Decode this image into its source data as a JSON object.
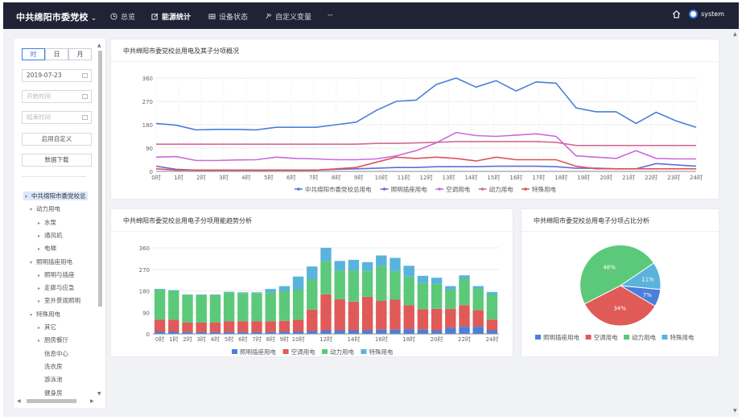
{
  "header": {
    "brand": "中共绵阳市委党校",
    "nav": [
      {
        "label": "总览",
        "icon": "clock-icon",
        "active": false
      },
      {
        "label": "能源统计",
        "icon": "edit-icon",
        "active": true
      },
      {
        "label": "设备状态",
        "icon": "grid-icon",
        "active": false
      },
      {
        "label": "自定义变量",
        "icon": "pin-icon",
        "active": false
      },
      {
        "label": "--",
        "icon": "",
        "active": false
      }
    ],
    "user": "system"
  },
  "sidebar": {
    "tabs": [
      "时",
      "日",
      "月"
    ],
    "date_value": "2019-07-23",
    "start_placeholder": "开始时间",
    "end_placeholder": "结束时间",
    "custom_button": "启用自定义",
    "download_button": "数据下载",
    "tree": [
      {
        "label": "中共绵阳市委党校总",
        "level": 0,
        "bullet": "▾",
        "selected": true
      },
      {
        "label": "动力用电",
        "level": 1,
        "bullet": "▾"
      },
      {
        "label": "水泵",
        "level": 2,
        "bullet": "▸"
      },
      {
        "label": "通风机",
        "level": 2,
        "bullet": "▸"
      },
      {
        "label": "电梯",
        "level": 2,
        "bullet": "▸"
      },
      {
        "label": "照明插座用电",
        "level": 1,
        "bullet": "▾"
      },
      {
        "label": "照明与插座",
        "level": 2,
        "bullet": "▸"
      },
      {
        "label": "走廊与应急",
        "level": 2,
        "bullet": "▸"
      },
      {
        "label": "室外景观照明",
        "level": 2,
        "bullet": "▸"
      },
      {
        "label": "特殊用电",
        "level": 1,
        "bullet": "▾"
      },
      {
        "label": "其它",
        "level": 2,
        "bullet": "▸"
      },
      {
        "label": "厨房餐厅",
        "level": 2,
        "bullet": "▸"
      },
      {
        "label": "信息中心",
        "level": 2,
        "bullet": ""
      },
      {
        "label": "洗衣房",
        "level": 2,
        "bullet": ""
      },
      {
        "label": "游泳池",
        "level": 2,
        "bullet": ""
      },
      {
        "label": "健身房",
        "level": 2,
        "bullet": ""
      }
    ]
  },
  "chart_data": [
    {
      "type": "line",
      "title": "中共绵阳市委党校总用电及其子分项概况",
      "x": [
        "0时",
        "1时",
        "2时",
        "3时",
        "4时",
        "5时",
        "6时",
        "7时",
        "8时",
        "9时",
        "10时",
        "11时",
        "12时",
        "13时",
        "14时",
        "15时",
        "16时",
        "17时",
        "18时",
        "19时",
        "20时",
        "21时",
        "22时",
        "23时",
        "24时"
      ],
      "ylim": [
        0,
        360
      ],
      "yticks": [
        "0",
        "90",
        "180",
        "270",
        "360"
      ],
      "series": [
        {
          "name": "中共绵阳市委党校总用电",
          "color": "#4a7fdc",
          "values": [
            185,
            178,
            160,
            162,
            162,
            160,
            170,
            170,
            170,
            180,
            190,
            235,
            270,
            275,
            335,
            360,
            325,
            350,
            310,
            345,
            340,
            245,
            230,
            230,
            185,
            228,
            195,
            170
          ]
        },
        {
          "name": "照明插座用电",
          "color": "#5e6fd8",
          "values": [
            20,
            8,
            5,
            5,
            5,
            5,
            5,
            5,
            5,
            8,
            10,
            12,
            15,
            15,
            18,
            18,
            18,
            20,
            20,
            20,
            18,
            12,
            12,
            10,
            10,
            30,
            25,
            20
          ]
        },
        {
          "name": "空调用电",
          "color": "#c96adf",
          "values": [
            55,
            57,
            42,
            42,
            44,
            45,
            55,
            50,
            48,
            45,
            45,
            48,
            60,
            80,
            110,
            150,
            138,
            135,
            140,
            145,
            135,
            60,
            55,
            50,
            80,
            50,
            48,
            48
          ]
        },
        {
          "name": "动力用电",
          "color": "#d46a96",
          "values": [
            105,
            105,
            105,
            105,
            105,
            105,
            105,
            105,
            105,
            105,
            105,
            108,
            108,
            110,
            112,
            115,
            115,
            115,
            115,
            115,
            112,
            100,
            100,
            100,
            100,
            100,
            100,
            100
          ]
        },
        {
          "name": "特殊用电",
          "color": "#e0525a",
          "values": [
            10,
            5,
            5,
            5,
            5,
            5,
            5,
            5,
            5,
            10,
            15,
            35,
            55,
            50,
            55,
            50,
            40,
            55,
            45,
            45,
            45,
            20,
            10,
            10,
            10,
            10,
            10,
            10
          ]
        }
      ]
    },
    {
      "type": "bar",
      "title": "中共绵阳市委党校总用电子分项用能趋势分析",
      "categories": [
        "0时",
        "1时",
        "2时",
        "3时",
        "4时",
        "5时",
        "6时",
        "7时",
        "8时",
        "9时",
        "10时",
        "11时",
        "12时",
        "13时",
        "14时",
        "15时",
        "16时",
        "17时",
        "18时",
        "19时",
        "20时",
        "21时",
        "22时",
        "23时",
        "24时"
      ],
      "xtick_labels": [
        "0时",
        "1时",
        "2时",
        "3时",
        "4时",
        "5时",
        "6时",
        "7时",
        "8时",
        "9时",
        "10时",
        "",
        "12时",
        "",
        "14时",
        "",
        "16时",
        "",
        "18时",
        "",
        "20时",
        "",
        "22时",
        "",
        "24时"
      ],
      "ylim": [
        0,
        360
      ],
      "yticks": [
        "0",
        "90",
        "180",
        "270",
        "360"
      ],
      "stacked": true,
      "series": [
        {
          "name": "照明插座用电",
          "color": "#4a7fdc",
          "values": [
            10,
            10,
            8,
            8,
            8,
            8,
            8,
            8,
            8,
            10,
            10,
            12,
            15,
            15,
            15,
            15,
            18,
            18,
            20,
            18,
            15,
            25,
            30,
            30,
            15
          ]
        },
        {
          "name": "空调用电",
          "color": "#e05a58",
          "values": [
            50,
            50,
            40,
            40,
            40,
            45,
            45,
            45,
            45,
            45,
            50,
            90,
            150,
            130,
            120,
            140,
            120,
            125,
            100,
            85,
            90,
            80,
            90,
            70,
            45
          ]
        },
        {
          "name": "动力用电",
          "color": "#5cc97a",
          "values": [
            125,
            120,
            115,
            115,
            115,
            120,
            118,
            118,
            120,
            125,
            125,
            125,
            140,
            120,
            130,
            110,
            145,
            120,
            120,
            110,
            105,
            80,
            110,
            90,
            105
          ]
        },
        {
          "name": "特殊用电",
          "color": "#5ab3dc",
          "values": [
            3,
            3,
            2,
            2,
            2,
            3,
            3,
            3,
            15,
            20,
            55,
            55,
            55,
            40,
            45,
            35,
            45,
            55,
            45,
            30,
            25,
            15,
            15,
            10,
            10
          ]
        }
      ]
    },
    {
      "type": "pie",
      "title": "中共绵阳市委党校总用电子分项占比分析",
      "slices": [
        {
          "name": "照明插座用电",
          "value": 7,
          "label": "7%",
          "color": "#4a7fdc"
        },
        {
          "name": "空调用电",
          "value": 34,
          "label": "34%",
          "color": "#e05a58"
        },
        {
          "name": "动力用电",
          "value": 48,
          "label": "48%",
          "color": "#5cc97a"
        },
        {
          "name": "特殊用电",
          "value": 11,
          "label": "11%",
          "color": "#5ab3dc"
        }
      ]
    }
  ]
}
